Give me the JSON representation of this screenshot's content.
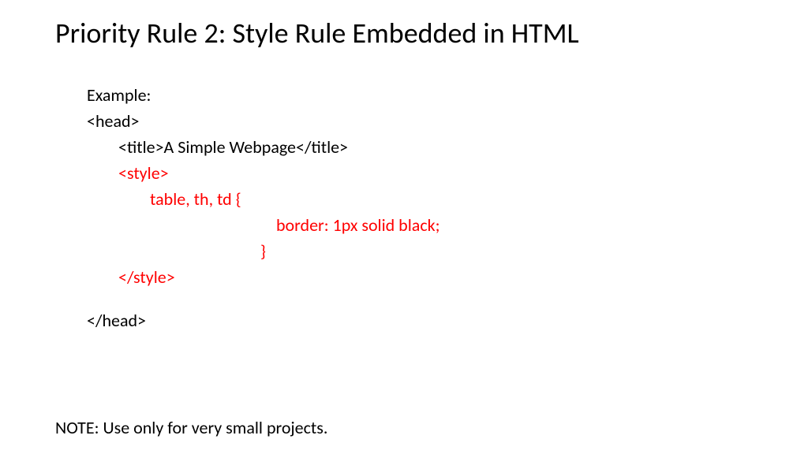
{
  "title": "Priority Rule 2: Style Rule Embedded in HTML",
  "code": {
    "line1": "Example:",
    "line2": "<head>",
    "line3": "<title>A Simple Webpage</title>",
    "line4": "<style>",
    "line5": "table, th, td {",
    "line6": "border: 1px solid black;",
    "line7": "}",
    "line8": "</style>",
    "line9": "</head>"
  },
  "note": "NOTE: Use only for very small projects."
}
